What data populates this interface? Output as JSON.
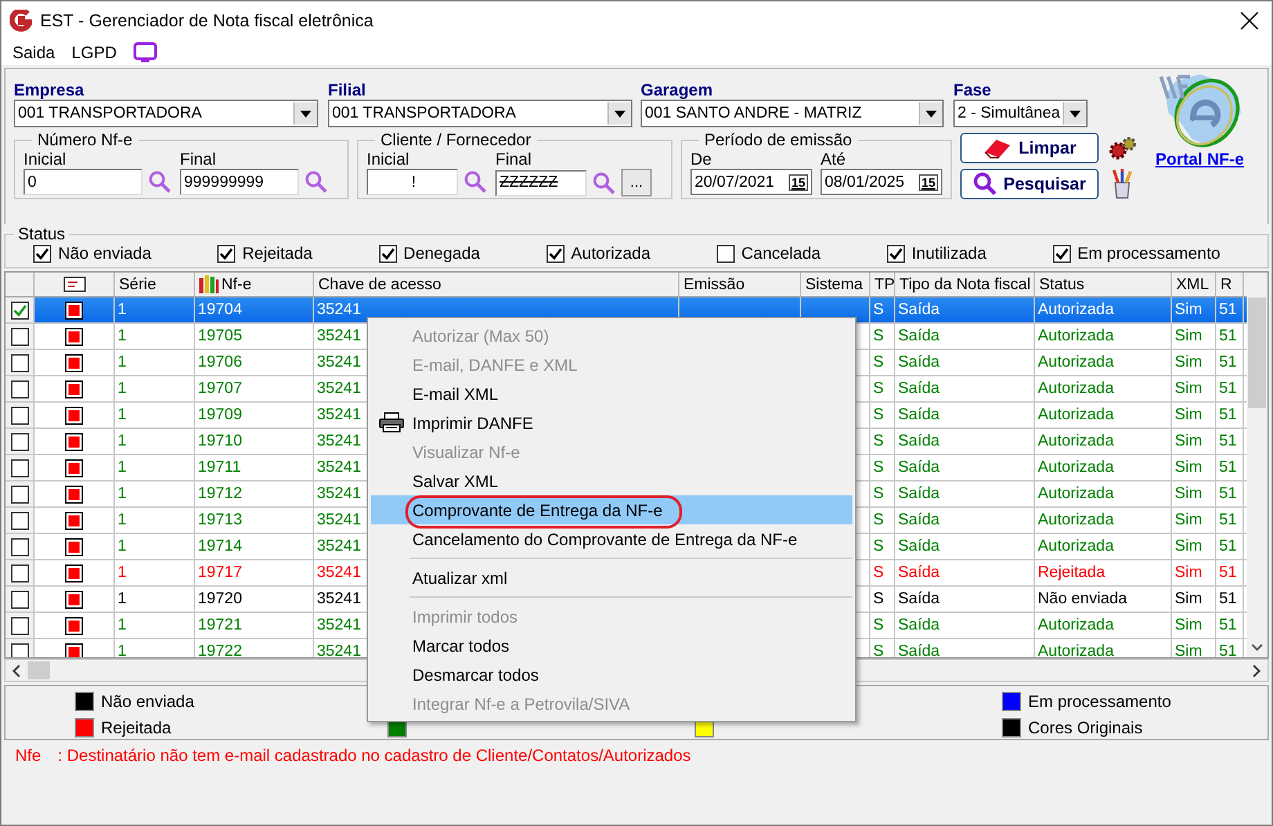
{
  "window": {
    "title": "EST - Gerenciador de Nota fiscal eletrônica"
  },
  "menu": [
    "Saida",
    "LGPD"
  ],
  "filters": {
    "empresa": {
      "label": "Empresa",
      "value": "001 TRANSPORTADORA"
    },
    "filial": {
      "label": "Filial",
      "value": "001 TRANSPORTADORA"
    },
    "garagem": {
      "label": "Garagem",
      "value": "001 SANTO ANDRE - MATRIZ"
    },
    "fase": {
      "label": "Fase",
      "value": "2 - Simultânea"
    }
  },
  "numero": {
    "title": "Número Nf-e",
    "fields": [
      {
        "label": "Inicial",
        "value": "0"
      },
      {
        "label": "Final",
        "value": "999999999"
      }
    ]
  },
  "cliente": {
    "title": "Cliente / Fornecedor",
    "fields": [
      {
        "label": "Inicial",
        "value": "!"
      },
      {
        "label": "Final",
        "value": "ZZZZZZ"
      }
    ],
    "more": "..."
  },
  "periodo": {
    "title": "Período de emissão",
    "fields": [
      {
        "label": "De",
        "value": "20/07/2021",
        "calendar": "15"
      },
      {
        "label": "Até",
        "value": "08/01/2025",
        "calendar": "15"
      }
    ]
  },
  "buttons": [
    "Limpar",
    "Pesquisar"
  ],
  "portal_link": "Portal NF-e",
  "status": {
    "title": "Status",
    "options": [
      {
        "label": "Não enviada",
        "checked": true
      },
      {
        "label": "Rejeitada",
        "checked": true
      },
      {
        "label": "Denegada",
        "checked": true
      },
      {
        "label": "Autorizada",
        "checked": true
      },
      {
        "label": "Cancelada",
        "checked": false
      },
      {
        "label": "Inutilizada",
        "checked": true
      },
      {
        "label": "Em processamento",
        "checked": true
      }
    ]
  },
  "table": {
    "columns": [
      "Série",
      "Nf-e",
      "Chave de acesso",
      "Emissão",
      "Sistema",
      "TP",
      "Tipo da Nota fiscal",
      "Status",
      "XML",
      "R"
    ],
    "rows": [
      {
        "checked": true,
        "selected": true,
        "color": "#ffffff",
        "serie": "1",
        "nfe": "19704",
        "chave": "35241",
        "tp": "S",
        "tipo": "Saída",
        "status": "Autorizada",
        "xml": "Sim",
        "re": "51"
      },
      {
        "checked": false,
        "selected": false,
        "color": "#008000",
        "serie": "1",
        "nfe": "19705",
        "chave": "35241",
        "tp": "S",
        "tipo": "Saída",
        "status": "Autorizada",
        "xml": "Sim",
        "re": "51"
      },
      {
        "checked": false,
        "selected": false,
        "color": "#008000",
        "serie": "1",
        "nfe": "19706",
        "chave": "35241",
        "tp": "S",
        "tipo": "Saída",
        "status": "Autorizada",
        "xml": "Sim",
        "re": "51"
      },
      {
        "checked": false,
        "selected": false,
        "color": "#008000",
        "serie": "1",
        "nfe": "19707",
        "chave": "35241",
        "tp": "S",
        "tipo": "Saída",
        "status": "Autorizada",
        "xml": "Sim",
        "re": "51"
      },
      {
        "checked": false,
        "selected": false,
        "color": "#008000",
        "serie": "1",
        "nfe": "19709",
        "chave": "35241",
        "tp": "S",
        "tipo": "Saída",
        "status": "Autorizada",
        "xml": "Sim",
        "re": "51"
      },
      {
        "checked": false,
        "selected": false,
        "color": "#008000",
        "serie": "1",
        "nfe": "19710",
        "chave": "35241",
        "tp": "S",
        "tipo": "Saída",
        "status": "Autorizada",
        "xml": "Sim",
        "re": "51"
      },
      {
        "checked": false,
        "selected": false,
        "color": "#008000",
        "serie": "1",
        "nfe": "19711",
        "chave": "35241",
        "tp": "S",
        "tipo": "Saída",
        "status": "Autorizada",
        "xml": "Sim",
        "re": "51"
      },
      {
        "checked": false,
        "selected": false,
        "color": "#008000",
        "serie": "1",
        "nfe": "19712",
        "chave": "35241",
        "tp": "S",
        "tipo": "Saída",
        "status": "Autorizada",
        "xml": "Sim",
        "re": "51"
      },
      {
        "checked": false,
        "selected": false,
        "color": "#008000",
        "serie": "1",
        "nfe": "19713",
        "chave": "35241",
        "tp": "S",
        "tipo": "Saída",
        "status": "Autorizada",
        "xml": "Sim",
        "re": "51"
      },
      {
        "checked": false,
        "selected": false,
        "color": "#008000",
        "serie": "1",
        "nfe": "19714",
        "chave": "35241",
        "tp": "S",
        "tipo": "Saída",
        "status": "Autorizada",
        "xml": "Sim",
        "re": "51"
      },
      {
        "checked": false,
        "selected": false,
        "color": "#ff0000",
        "serie": "1",
        "nfe": "19717",
        "chave": "35241",
        "tp": "S",
        "tipo": "Saída",
        "status": "Rejeitada",
        "xml": "Sim",
        "re": "51"
      },
      {
        "checked": false,
        "selected": false,
        "color": "#000000",
        "serie": "1",
        "nfe": "19720",
        "chave": "35241",
        "tp": "S",
        "tipo": "Saída",
        "status": "Não enviada",
        "xml": "Sim",
        "re": "51"
      },
      {
        "checked": false,
        "selected": false,
        "color": "#008000",
        "serie": "1",
        "nfe": "19721",
        "chave": "35241",
        "tp": "S",
        "tipo": "Saída",
        "status": "Autorizada",
        "xml": "Sim",
        "re": "51"
      },
      {
        "checked": false,
        "selected": false,
        "color": "#008000",
        "serie": "1",
        "nfe": "19722",
        "chave": "35241",
        "tp": "S",
        "tipo": "Saída",
        "status": "Autorizada",
        "xml": "Sim",
        "re": "51"
      }
    ]
  },
  "context_menu": [
    {
      "kind": "item",
      "label": "Autorizar (Max 50)",
      "disabled": true
    },
    {
      "kind": "item",
      "label": "E-mail, DANFE e XML",
      "disabled": true
    },
    {
      "kind": "item",
      "label": "E-mail XML",
      "disabled": false
    },
    {
      "kind": "print",
      "label": "Imprimir DANFE",
      "disabled": false
    },
    {
      "kind": "item",
      "label": "Visualizar Nf-e",
      "disabled": true
    },
    {
      "kind": "item",
      "label": "Salvar XML",
      "disabled": false
    },
    {
      "kind": "item",
      "label": "Comprovante de Entrega da NF-e",
      "disabled": false,
      "selected": true,
      "circled": true
    },
    {
      "kind": "item",
      "label": "Cancelamento do Comprovante de Entrega da NF-e",
      "disabled": false
    },
    {
      "kind": "separator"
    },
    {
      "kind": "item",
      "label": "Atualizar xml",
      "disabled": false
    },
    {
      "kind": "separator"
    },
    {
      "kind": "item",
      "label": "Imprimir todos",
      "disabled": true
    },
    {
      "kind": "item",
      "label": "Marcar todos",
      "disabled": false
    },
    {
      "kind": "item",
      "label": "Desmarcar todos",
      "disabled": false
    },
    {
      "kind": "item",
      "label": "Integrar Nf-e a Petrovila/SIVA",
      "disabled": true
    }
  ],
  "legend": [
    [
      {
        "label": "Não enviada",
        "color": "#000000"
      },
      {
        "label": "Rejeitada",
        "color": "#ff0000"
      }
    ],
    [
      {
        "color": "#008000"
      }
    ],
    [
      {
        "color": "#ffff00"
      }
    ],
    [
      {
        "label": "Em processamento",
        "color": "#0000ff"
      },
      {
        "label": "Cores Originais",
        "color": "#000000"
      }
    ]
  ],
  "message": {
    "field": "Nfe",
    "text": ": Destinatário não tem e-mail cadastrado no cadastro de Cliente/Contatos/Autorizados"
  }
}
